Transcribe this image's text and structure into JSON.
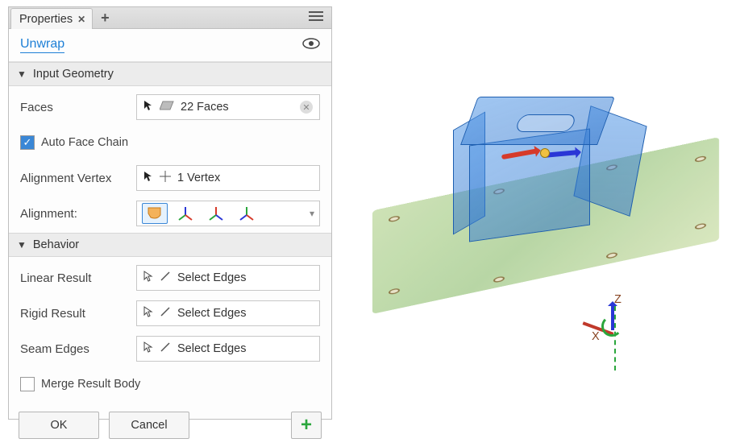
{
  "tabbar": {
    "properties_tab": "Properties"
  },
  "header": {
    "title": "Unwrap"
  },
  "sections": {
    "input_geometry": {
      "title": "Input Geometry",
      "faces_label": "Faces",
      "faces_value": "22 Faces",
      "auto_face_chain_label": "Auto Face Chain",
      "auto_face_chain_checked": true,
      "alignment_vertex_label": "Alignment Vertex",
      "alignment_vertex_value": "1 Vertex",
      "alignment_label": "Alignment:"
    },
    "behavior": {
      "title": "Behavior",
      "linear_result_label": "Linear Result",
      "linear_result_value": "Select Edges",
      "rigid_result_label": "Rigid Result",
      "rigid_result_value": "Select Edges",
      "seam_edges_label": "Seam Edges",
      "seam_edges_value": "Select Edges",
      "merge_result_body_label": "Merge Result Body",
      "merge_result_body_checked": false
    }
  },
  "footer": {
    "ok": "OK",
    "cancel": "Cancel"
  },
  "viewport": {
    "axis_z": "Z",
    "axis_x": "X"
  }
}
